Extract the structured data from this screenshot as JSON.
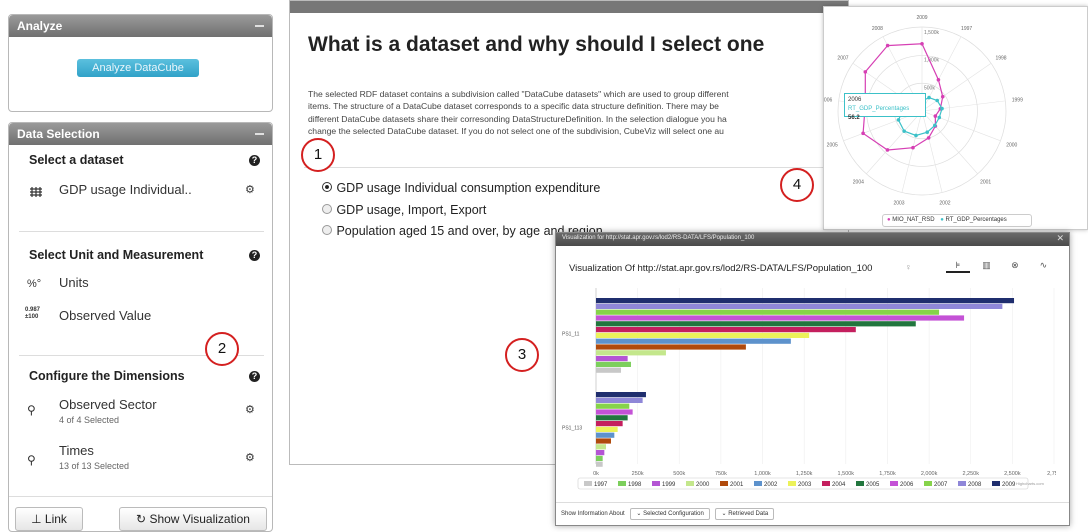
{
  "analyze": {
    "title": "Analyze",
    "button": "Analyze DataCube"
  },
  "data_selection": {
    "title": "Data Selection",
    "dataset_section": {
      "title": "Select a dataset",
      "item": "GDP usage Individual.."
    },
    "unit_section": {
      "title": "Select Unit and Measurement",
      "units": "Units",
      "measure": "Observed Value",
      "measure_icon_text": "0.987 ±100"
    },
    "dimensions_section": {
      "title": "Configure the Dimensions",
      "items": [
        {
          "label": "Observed Sector",
          "sub": "4 of 4 Selected"
        },
        {
          "label": "Times",
          "sub": "13 of 13 Selected"
        }
      ]
    },
    "link_button": "Link",
    "show_button": "Show Visualization"
  },
  "dialog": {
    "title": "What is a dataset and why should I select one",
    "body_lines": [
      "The selected RDF dataset contains a subdivision called \"DataCube datasets\" which are used to group different",
      "items. The structure of a DataCube dataset corresponds to a specific data structure definition. There may be",
      "different DataCube datasets share their corresonding DataStructureDefinition. In the selection dialogue you ha",
      "change the selected DataCube dataset. If you do not select one of the subdivision, CubeViz will select one au"
    ],
    "options": [
      {
        "label": "GDP usage Individual consumption expenditure",
        "selected": true
      },
      {
        "label": "GDP usage, Import, Export",
        "selected": false
      },
      {
        "label": "Population aged 15 and over, by age and region",
        "selected": false
      }
    ]
  },
  "callouts": [
    "1",
    "2",
    "3",
    "4"
  ],
  "polar": {
    "angle_labels": [
      "2009",
      "1997",
      "1998",
      "1999",
      "2000",
      "2001",
      "2002",
      "2003",
      "2004",
      "2005",
      "2006",
      "2007",
      "2008"
    ],
    "radial_labels": [
      "1,500k",
      "1,000k",
      "500k"
    ],
    "tooltip": {
      "year": "2006",
      "series": "RT_GDP_Percentages",
      "value": "56.2"
    },
    "legend": [
      "MIO_NAT_RSD",
      "RT_GDP_Percentages"
    ],
    "colors": {
      "series1": "#d63fb4",
      "series2": "#3cc1c8"
    }
  },
  "viz": {
    "window_title": "Visualization for http://stat.apr.gov.rs/lod2/RS-DATA/LFS/Population_100",
    "heading": "Visualization Of http://stat.apr.gov.rs/lod2/RS-DATA/LFS/Population_100",
    "footer_label": "Show Information About",
    "footer_btn1": "Selected Configuration",
    "footer_btn2": "Retrieved Data",
    "credit": "Highcharts.com"
  },
  "chart_data": {
    "type": "bar",
    "orientation": "horizontal",
    "categories": [
      "PS1_11",
      "PS1_113"
    ],
    "x_ticks": [
      "0k",
      "250k",
      "500k",
      "750k",
      "1,000k",
      "1,250k",
      "1,500k",
      "1,750k",
      "2,000k",
      "2,250k",
      "2,500k",
      "2,750"
    ],
    "xlim": [
      0,
      2750
    ],
    "series": [
      {
        "name": "1997",
        "color": "#c8c8c8",
        "values": [
          150,
          40
        ]
      },
      {
        "name": "1998",
        "color": "#7ccf5c",
        "values": [
          210,
          40
        ]
      },
      {
        "name": "1999",
        "color": "#b455d4",
        "values": [
          190,
          50
        ]
      },
      {
        "name": "2000",
        "color": "#c4e78c",
        "values": [
          420,
          60
        ]
      },
      {
        "name": "2001",
        "color": "#b04a0c",
        "values": [
          900,
          90
        ]
      },
      {
        "name": "2002",
        "color": "#5d92cc",
        "values": [
          1170,
          110
        ]
      },
      {
        "name": "2003",
        "color": "#ecf25a",
        "values": [
          1280,
          130
        ]
      },
      {
        "name": "2004",
        "color": "#c41f5e",
        "values": [
          1560,
          160
        ]
      },
      {
        "name": "2005",
        "color": "#22763e",
        "values": [
          1920,
          190
        ]
      },
      {
        "name": "2006",
        "color": "#c452d6",
        "values": [
          2210,
          220
        ]
      },
      {
        "name": "2007",
        "color": "#86d34a",
        "values": [
          2060,
          200
        ]
      },
      {
        "name": "2008",
        "color": "#8f87d8",
        "values": [
          2440,
          280
        ]
      },
      {
        "name": "2009",
        "color": "#1f2e6e",
        "values": [
          2510,
          300
        ]
      }
    ]
  }
}
